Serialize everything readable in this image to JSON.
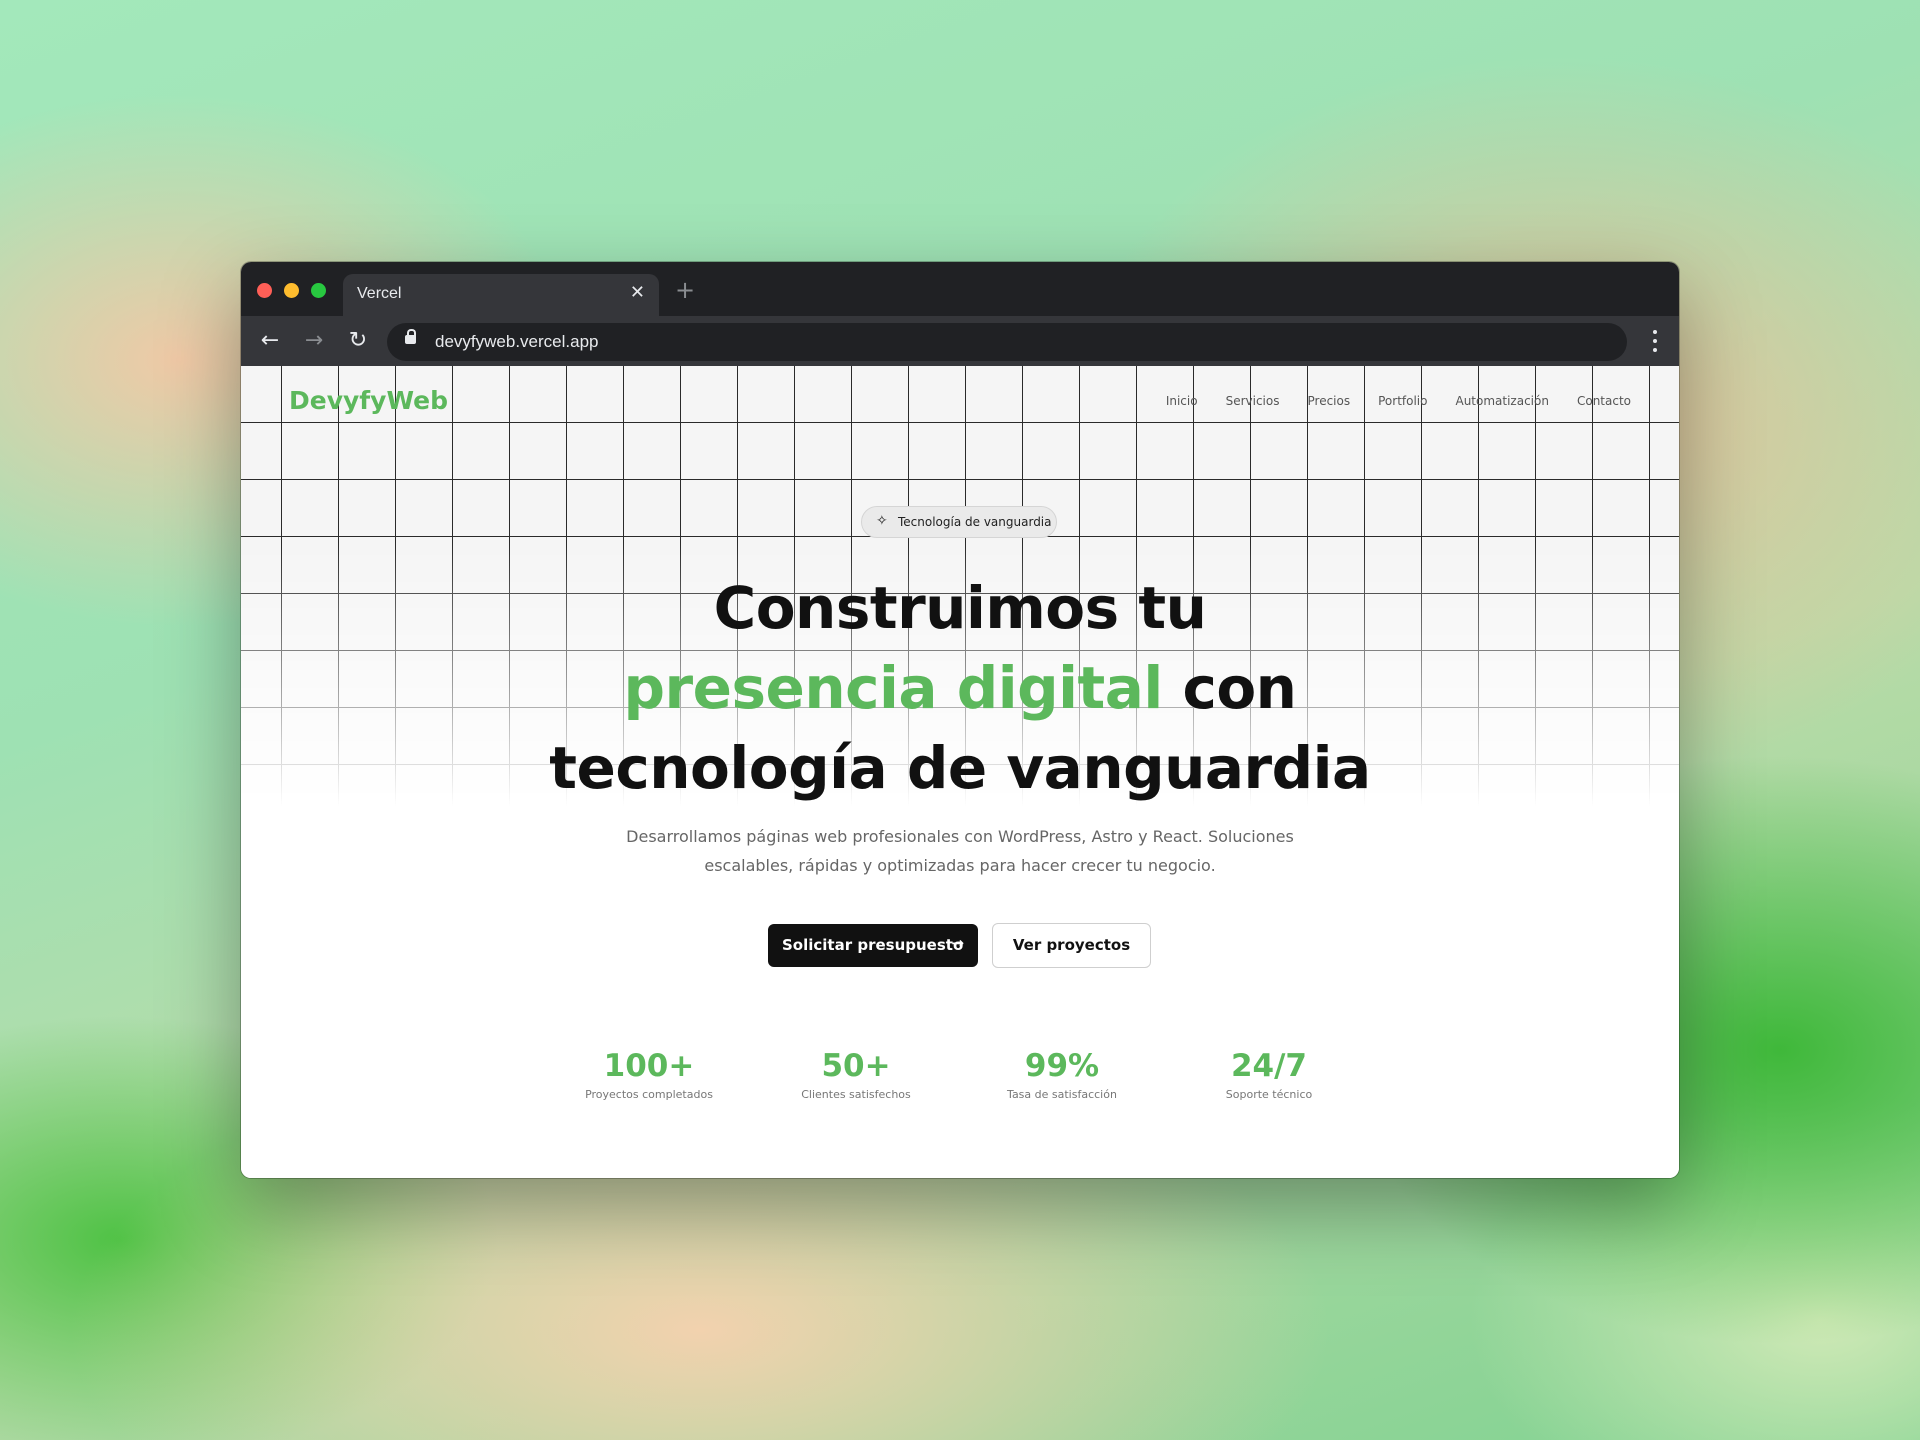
{
  "browser": {
    "tab_title": "Vercel",
    "tab_close": "✕",
    "new_tab": "+",
    "url": "devyfyweb.vercel.app"
  },
  "site": {
    "logo": "DevyfyWeb",
    "nav": [
      "Inicio",
      "Servicios",
      "Precios",
      "Portfolio",
      "Automatización",
      "Contacto"
    ],
    "badge": "Tecnología de vanguardia",
    "headline": {
      "line1": "Construimos tu",
      "highlight": "presencia digital",
      "line2_rest": "con",
      "line3": "tecnología de vanguardia"
    },
    "subtitle": "Desarrollamos páginas web profesionales con WordPress, Astro y React. Soluciones escalables, rápidas y optimizadas para hacer crecer tu negocio.",
    "cta_primary": "Solicitar presupuesto",
    "cta_secondary": "Ver proyectos",
    "stats": [
      {
        "value": "100+",
        "label": "Proyectos completados"
      },
      {
        "value": "50+",
        "label": "Clientes satisfechos"
      },
      {
        "value": "99%",
        "label": "Tasa de satisfacción"
      },
      {
        "value": "24/7",
        "label": "Soporte técnico"
      }
    ]
  },
  "colors": {
    "accent": "#5cb85c",
    "chrome_dark": "#202124",
    "button_dark": "#111111"
  },
  "icons": {
    "badge": "sparkle-icon",
    "cta": "arrow-right-icon"
  }
}
